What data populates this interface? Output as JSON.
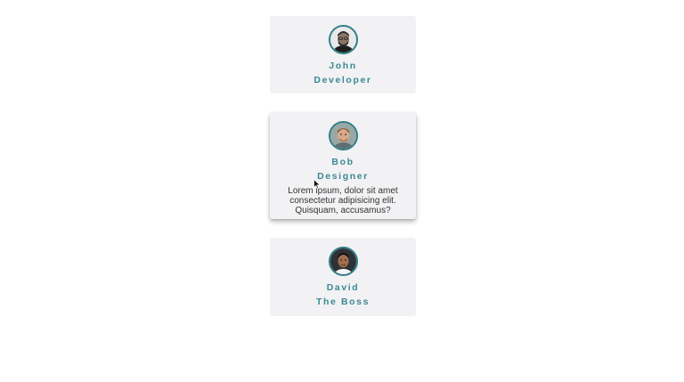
{
  "team": {
    "members": [
      {
        "name": "John",
        "role": "Developer",
        "description": ""
      },
      {
        "name": "Bob",
        "role": "Designer",
        "description": "Lorem ipsum, dolor sit amet consectetur adipisicing elit. Quisquam, accusamus?"
      },
      {
        "name": "David",
        "role": "The Boss",
        "description": ""
      }
    ]
  },
  "colors": {
    "accent": "#3a8a94",
    "card_bg": "#f2f1f3",
    "avatar_ring": "#2f7f86"
  }
}
